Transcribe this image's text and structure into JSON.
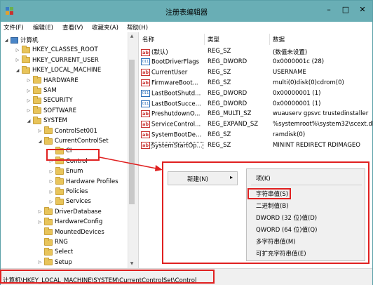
{
  "window": {
    "title": "注册表编辑器"
  },
  "menubar": [
    "文件(F)",
    "编辑(E)",
    "查看(V)",
    "收藏夹(A)",
    "帮助(H)"
  ],
  "tree": [
    {
      "label": "计算机",
      "exp": "◢",
      "kind": "pc"
    },
    {
      "label": "HKEY_CLASSES_ROOT",
      "exp": "▷",
      "kind": "folder"
    },
    {
      "label": "HKEY_CURRENT_USER",
      "exp": "▷",
      "kind": "folder"
    },
    {
      "label": "HKEY_LOCAL_MACHINE",
      "exp": "◢",
      "kind": "folder"
    },
    {
      "label": "HARDWARE",
      "exp": "▷",
      "kind": "folder"
    },
    {
      "label": "SAM",
      "exp": "▷",
      "kind": "folder"
    },
    {
      "label": "SECURITY",
      "exp": "▷",
      "kind": "folder"
    },
    {
      "label": "SOFTWARE",
      "exp": "▷",
      "kind": "folder"
    },
    {
      "label": "SYSTEM",
      "exp": "◢",
      "kind": "folder"
    },
    {
      "label": "ControlSet001",
      "exp": "▷",
      "kind": "folder"
    },
    {
      "label": "CurrentControlSet",
      "exp": "◢",
      "kind": "folder"
    },
    {
      "label": "CI",
      "exp": "",
      "kind": "folder"
    },
    {
      "label": "Control",
      "exp": "▷",
      "kind": "folder"
    },
    {
      "label": "Enum",
      "exp": "▷",
      "kind": "folder"
    },
    {
      "label": "Hardware Profiles",
      "exp": "▷",
      "kind": "folder"
    },
    {
      "label": "Policies",
      "exp": "▷",
      "kind": "folder"
    },
    {
      "label": "Services",
      "exp": "▷",
      "kind": "folder"
    },
    {
      "label": "DriverDatabase",
      "exp": "▷",
      "kind": "folder"
    },
    {
      "label": "HardwareConfig",
      "exp": "▷",
      "kind": "folder"
    },
    {
      "label": "MountedDevices",
      "exp": "",
      "kind": "folder"
    },
    {
      "label": "RNG",
      "exp": "",
      "kind": "folder"
    },
    {
      "label": "Select",
      "exp": "",
      "kind": "folder"
    },
    {
      "label": "Setup",
      "exp": "▷",
      "kind": "folder"
    },
    {
      "label": "WPA",
      "exp": "▷",
      "kind": "folder"
    }
  ],
  "columns": {
    "name": "名称",
    "type": "类型",
    "data": "数据"
  },
  "values": [
    {
      "icon": "ab",
      "name": "(默认)",
      "type": "REG_SZ",
      "data": "(数值未设置)"
    },
    {
      "icon": "bin",
      "name": "BootDriverFlags",
      "type": "REG_DWORD",
      "data": "0x0000001c (28)"
    },
    {
      "icon": "ab",
      "name": "CurrentUser",
      "type": "REG_SZ",
      "data": "USERNAME"
    },
    {
      "icon": "ab",
      "name": "FirmwareBoot...",
      "type": "REG_SZ",
      "data": "multi(0)disk(0)cdrom(0)"
    },
    {
      "icon": "bin",
      "name": "LastBootShutd...",
      "type": "REG_DWORD",
      "data": "0x00000001 (1)"
    },
    {
      "icon": "bin",
      "name": "LastBootSucce...",
      "type": "REG_DWORD",
      "data": "0x00000001 (1)"
    },
    {
      "icon": "ab",
      "name": "PreshutdownO...",
      "type": "REG_MULTI_SZ",
      "data": "wuauserv gpsvc trustedinstaller"
    },
    {
      "icon": "ab",
      "name": "ServiceControl...",
      "type": "REG_EXPAND_SZ",
      "data": "%systemroot%\\system32\\scext.dll"
    },
    {
      "icon": "ab",
      "name": "SystemBootDe...",
      "type": "REG_SZ",
      "data": "ramdisk(0)"
    },
    {
      "icon": "ab",
      "name": "SystemStartOp...",
      "type": "REG_SZ",
      "data": "MININT  REDIRECT RDIMAGEO"
    }
  ],
  "context_menu": {
    "main": {
      "label": "新建(N)",
      "arrow": "▸"
    },
    "submenu": [
      "项(K)",
      "字符串值(S)",
      "二进制值(B)",
      "DWORD (32 位)值(D)",
      "QWORD (64 位)值(Q)",
      "多字符串值(M)",
      "可扩充字符串值(E)"
    ]
  },
  "status": {
    "path": "计算机\\HKEY_LOCAL_MACHINE\\SYSTEM\\CurrentControlSet\\Control"
  },
  "colors": {
    "titlebar": "#69aeb5",
    "highlight": "#e02020"
  }
}
